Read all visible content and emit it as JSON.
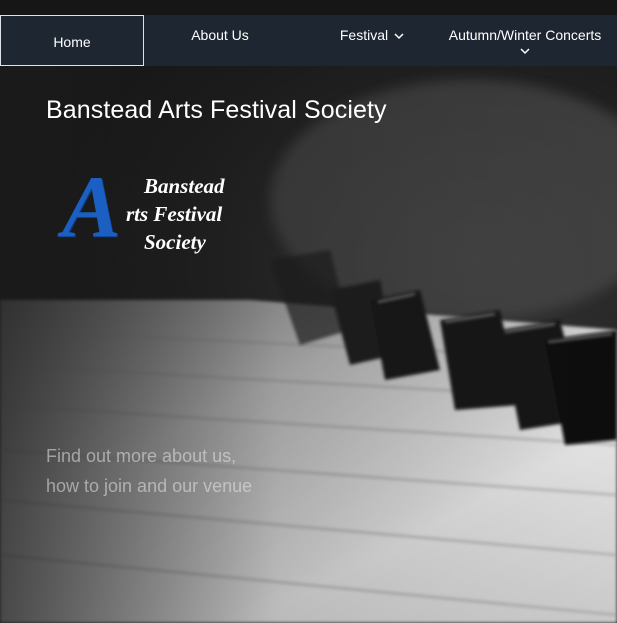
{
  "nav": {
    "items": [
      {
        "label": "Home"
      },
      {
        "label": "About Us"
      },
      {
        "label": "Festival"
      },
      {
        "label": "Autumn/Winter Concerts"
      }
    ]
  },
  "hero": {
    "title": "Banstead Arts Festival Society",
    "logo": {
      "big_letter": "A",
      "line1": "Banstead",
      "line2": "rts Festival",
      "line3": "Society",
      "color": "#1b5fc2"
    },
    "tagline": {
      "line1": "Find out more about us,",
      "line2": "how to join and our venue"
    },
    "background": "piano-keys-photo"
  },
  "colors": {
    "nav_bg": "#1e2632",
    "accent": "#1b5fc2"
  }
}
